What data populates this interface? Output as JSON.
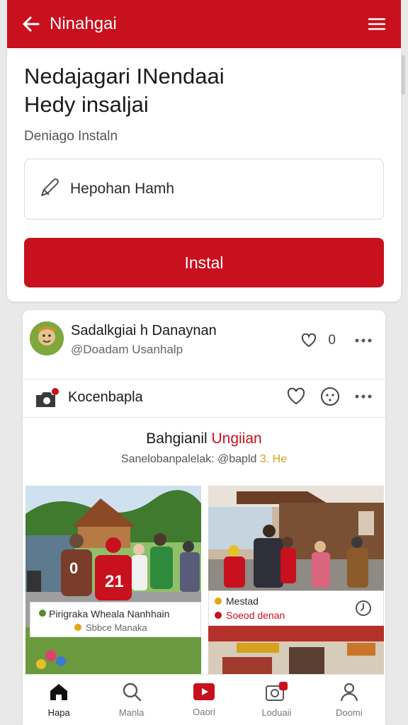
{
  "topbar": {
    "title": "Ninahgai"
  },
  "hero": {
    "title_line1": "Nedajagari INendaai",
    "title_line2": "Hedy insaljai",
    "subtitle": "Deniago Instaln",
    "field_value": "Hepohan Hamh",
    "button_label": "Instal"
  },
  "post": {
    "name": "Sadalkgiai h Danaynan",
    "handle": "@Doadam Usanhalp",
    "header_count": "0",
    "section_label": "Kocenbapla",
    "story_title_a": "Bahgianil ",
    "story_title_b": "Ungiian",
    "story_sub_a": "Sanelobanpalelak: @bapld ",
    "story_sub_b": "3. He",
    "photo1_caption": "Pirigraka Wheala Nanhhain",
    "photo1_sub": "Sbbce Manaka",
    "photo2_caption": "Mestad",
    "photo2_sub": "Soeod denan",
    "jersey_a": "0",
    "jersey_b": "21"
  },
  "tabs": [
    {
      "label": "Hapa"
    },
    {
      "label": "Manla"
    },
    {
      "label": "Oaori"
    },
    {
      "label": "Loduaii"
    },
    {
      "label": "Doomi"
    }
  ],
  "colors": {
    "brand": "#c8101e",
    "accent_gold": "#e2a614",
    "accent_green": "#5a8a2a"
  },
  "icons": [
    "back-arrow-icon",
    "hamburger-menu-icon",
    "pencil-icon",
    "heart-icon",
    "more-icon",
    "camera-icon",
    "home-icon",
    "search-icon",
    "play-icon",
    "clock-icon",
    "profile-icon"
  ]
}
